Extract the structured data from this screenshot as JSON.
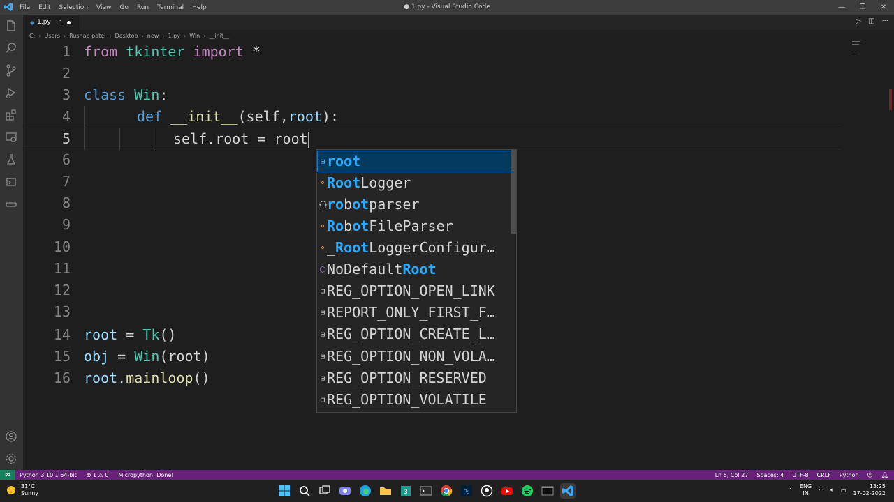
{
  "titlebar": {
    "menu": [
      "File",
      "Edit",
      "Selection",
      "View",
      "Go",
      "Run",
      "Terminal",
      "Help"
    ],
    "title": "● 1.py - Visual Studio Code"
  },
  "tab": {
    "name": "1.py",
    "badge": "1"
  },
  "breadcrumb": [
    "C:",
    "Users",
    "Rushab patel",
    "Desktop",
    "new",
    "1.py",
    "Win",
    "__init__"
  ],
  "code_lines": [
    {
      "n": "1"
    },
    {
      "n": "2"
    },
    {
      "n": "3"
    },
    {
      "n": "4"
    },
    {
      "n": "5"
    },
    {
      "n": "6"
    },
    {
      "n": "7"
    },
    {
      "n": "8"
    },
    {
      "n": "9"
    },
    {
      "n": "10"
    },
    {
      "n": "11"
    },
    {
      "n": "12"
    },
    {
      "n": "13"
    },
    {
      "n": "14"
    },
    {
      "n": "15"
    },
    {
      "n": "16"
    }
  ],
  "code": {
    "l1": {
      "kw": "from",
      "mod": "tkinter",
      "kw2": "import",
      "rest": "*"
    },
    "l3": {
      "kw": "class",
      "name": "Win",
      "rest": ":"
    },
    "l4": {
      "kw": "def",
      "fn": "__init__",
      "p1": "(self,",
      "p2": "root",
      "p3": "):"
    },
    "l5": {
      "text": "self.root = root"
    },
    "l14": {
      "var": "root",
      "eq": " = ",
      "cls": "Tk",
      "rest": "()"
    },
    "l15": {
      "var": "obj",
      "eq": " = ",
      "cls": "Win",
      "p": "(root)"
    },
    "l16": {
      "var": "root",
      "dot": ".",
      "fn": "mainloop",
      "rest": "()"
    }
  },
  "suggestions": [
    {
      "icon": "variable-icon",
      "hl": "root",
      "rest": ""
    },
    {
      "icon": "class-icon",
      "hl": "Root",
      "rest": "Logger"
    },
    {
      "icon": "module-icon",
      "pre": "",
      "hl": "ro",
      "mid": "b",
      "hl2": "ot",
      "rest": "parser"
    },
    {
      "icon": "class-icon",
      "hl": "Ro",
      "mid": "b",
      "hl2": "ot",
      "rest": "FileParser"
    },
    {
      "icon": "class-icon",
      "pre": "_",
      "hl": "Root",
      "rest": "LoggerConfigur…"
    },
    {
      "icon": "struct-icon",
      "pre": "NoDefault",
      "hl": "Root",
      "rest": ""
    },
    {
      "icon": "constant-icon",
      "text": "REG_OPTION_OPEN_LINK"
    },
    {
      "icon": "constant-icon",
      "text": "REPORT_ONLY_FIRST_F…"
    },
    {
      "icon": "constant-icon",
      "text": "REG_OPTION_CREATE_L…"
    },
    {
      "icon": "constant-icon",
      "text": "REG_OPTION_NON_VOLA…"
    },
    {
      "icon": "constant-icon",
      "text": "REG_OPTION_RESERVED"
    },
    {
      "icon": "constant-icon",
      "text": "REG_OPTION_VOLATILE"
    }
  ],
  "statusbar": {
    "python": "Python 3.10.1 64-bit",
    "problems": "⊗ 1 ⚠ 0",
    "micropython": "Micropython: Done!",
    "position": "Ln 5, Col 27",
    "spaces": "Spaces: 4",
    "encoding": "UTF-8",
    "eol": "CRLF",
    "language": "Python"
  },
  "taskbar": {
    "temp": "31°C",
    "weather": "Sunny",
    "lang1": "ENG",
    "lang2": "IN",
    "time": "13:25",
    "date": "17-02-2022"
  },
  "colors": {
    "statusbar": "#68217a",
    "remote": "#16825d",
    "selection": "#04395e",
    "match": "#2aaaff"
  }
}
